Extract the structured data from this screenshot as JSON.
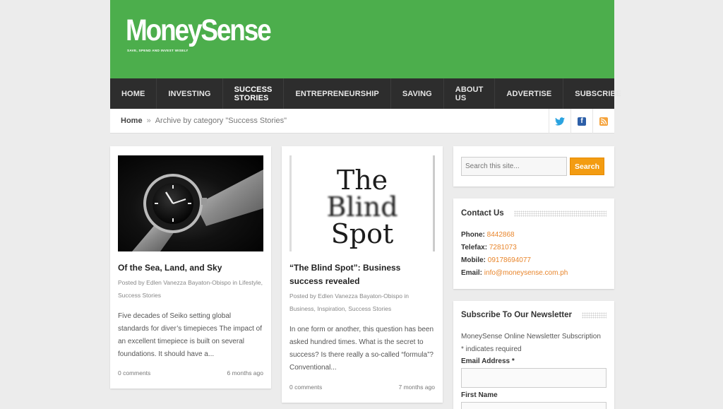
{
  "brand": {
    "name": "MoneySense",
    "tagline": "SAVE, SPEND AND INVEST WISELY"
  },
  "nav": [
    {
      "label": "Home",
      "active": false
    },
    {
      "label": "Investing",
      "active": false
    },
    {
      "label": "Success Stories",
      "active": true
    },
    {
      "label": "Entrepreneurship",
      "active": false
    },
    {
      "label": "Saving",
      "active": false
    },
    {
      "label": "About Us",
      "active": false
    },
    {
      "label": "Advertise",
      "active": false
    },
    {
      "label": "Subscribe",
      "active": false
    }
  ],
  "breadcrumb": {
    "home": "Home",
    "separator": "»",
    "current": "Archive by category \"Success Stories\""
  },
  "social": [
    "twitter-icon",
    "facebook-icon",
    "rss-icon"
  ],
  "posts": [
    {
      "title": "Of the Sea, Land, and Sky",
      "meta_prefix": "Posted by Edlen Vanezza Bayaton-Obispo in",
      "categories": [
        "Lifestyle",
        "Success Stories"
      ],
      "excerpt": "Five decades of Seiko setting global standards for diver’s timepieces The impact of an excellent timepiece is built on several foundations. It should have a...",
      "comments": "0 comments",
      "age": "6 months ago"
    },
    {
      "title": "“The Blind Spot”: Business success revealed",
      "meta_prefix": "Posted by Edlen Vanezza Bayaton-Obispo in",
      "categories": [
        "Business",
        "Inspiration",
        "Success Stories"
      ],
      "image_text": {
        "line1": "The",
        "line2": "Blind",
        "line3": "Spot"
      },
      "excerpt": "In one form or another, this question has been asked hundred times. What is the secret to success? Is there really a so-called “formula”? Conventional...",
      "comments": "0 comments",
      "age": "7 months ago"
    }
  ],
  "search": {
    "placeholder": "Search this site...",
    "button": "Search"
  },
  "contact": {
    "title": "Contact Us",
    "phone_label": "Phone:",
    "phone": "8442868",
    "telefax_label": "Telefax:",
    "telefax": "7281073",
    "mobile_label": "Mobile:",
    "mobile": "09178694077",
    "email_label": "Email:",
    "email": "info@moneysense.com.ph"
  },
  "newsletter": {
    "title": "Subscribe To Our Newsletter",
    "description": "MoneySense Online Newsletter Subscription",
    "required_note": "* indicates required",
    "email_label": "Email Address *",
    "first_name_label": "First Name"
  },
  "colors": {
    "header_green": "#4cae4c",
    "nav_dark": "#2d2d2d",
    "accent_orange": "#f39c12",
    "link_orange": "#e8852b"
  }
}
